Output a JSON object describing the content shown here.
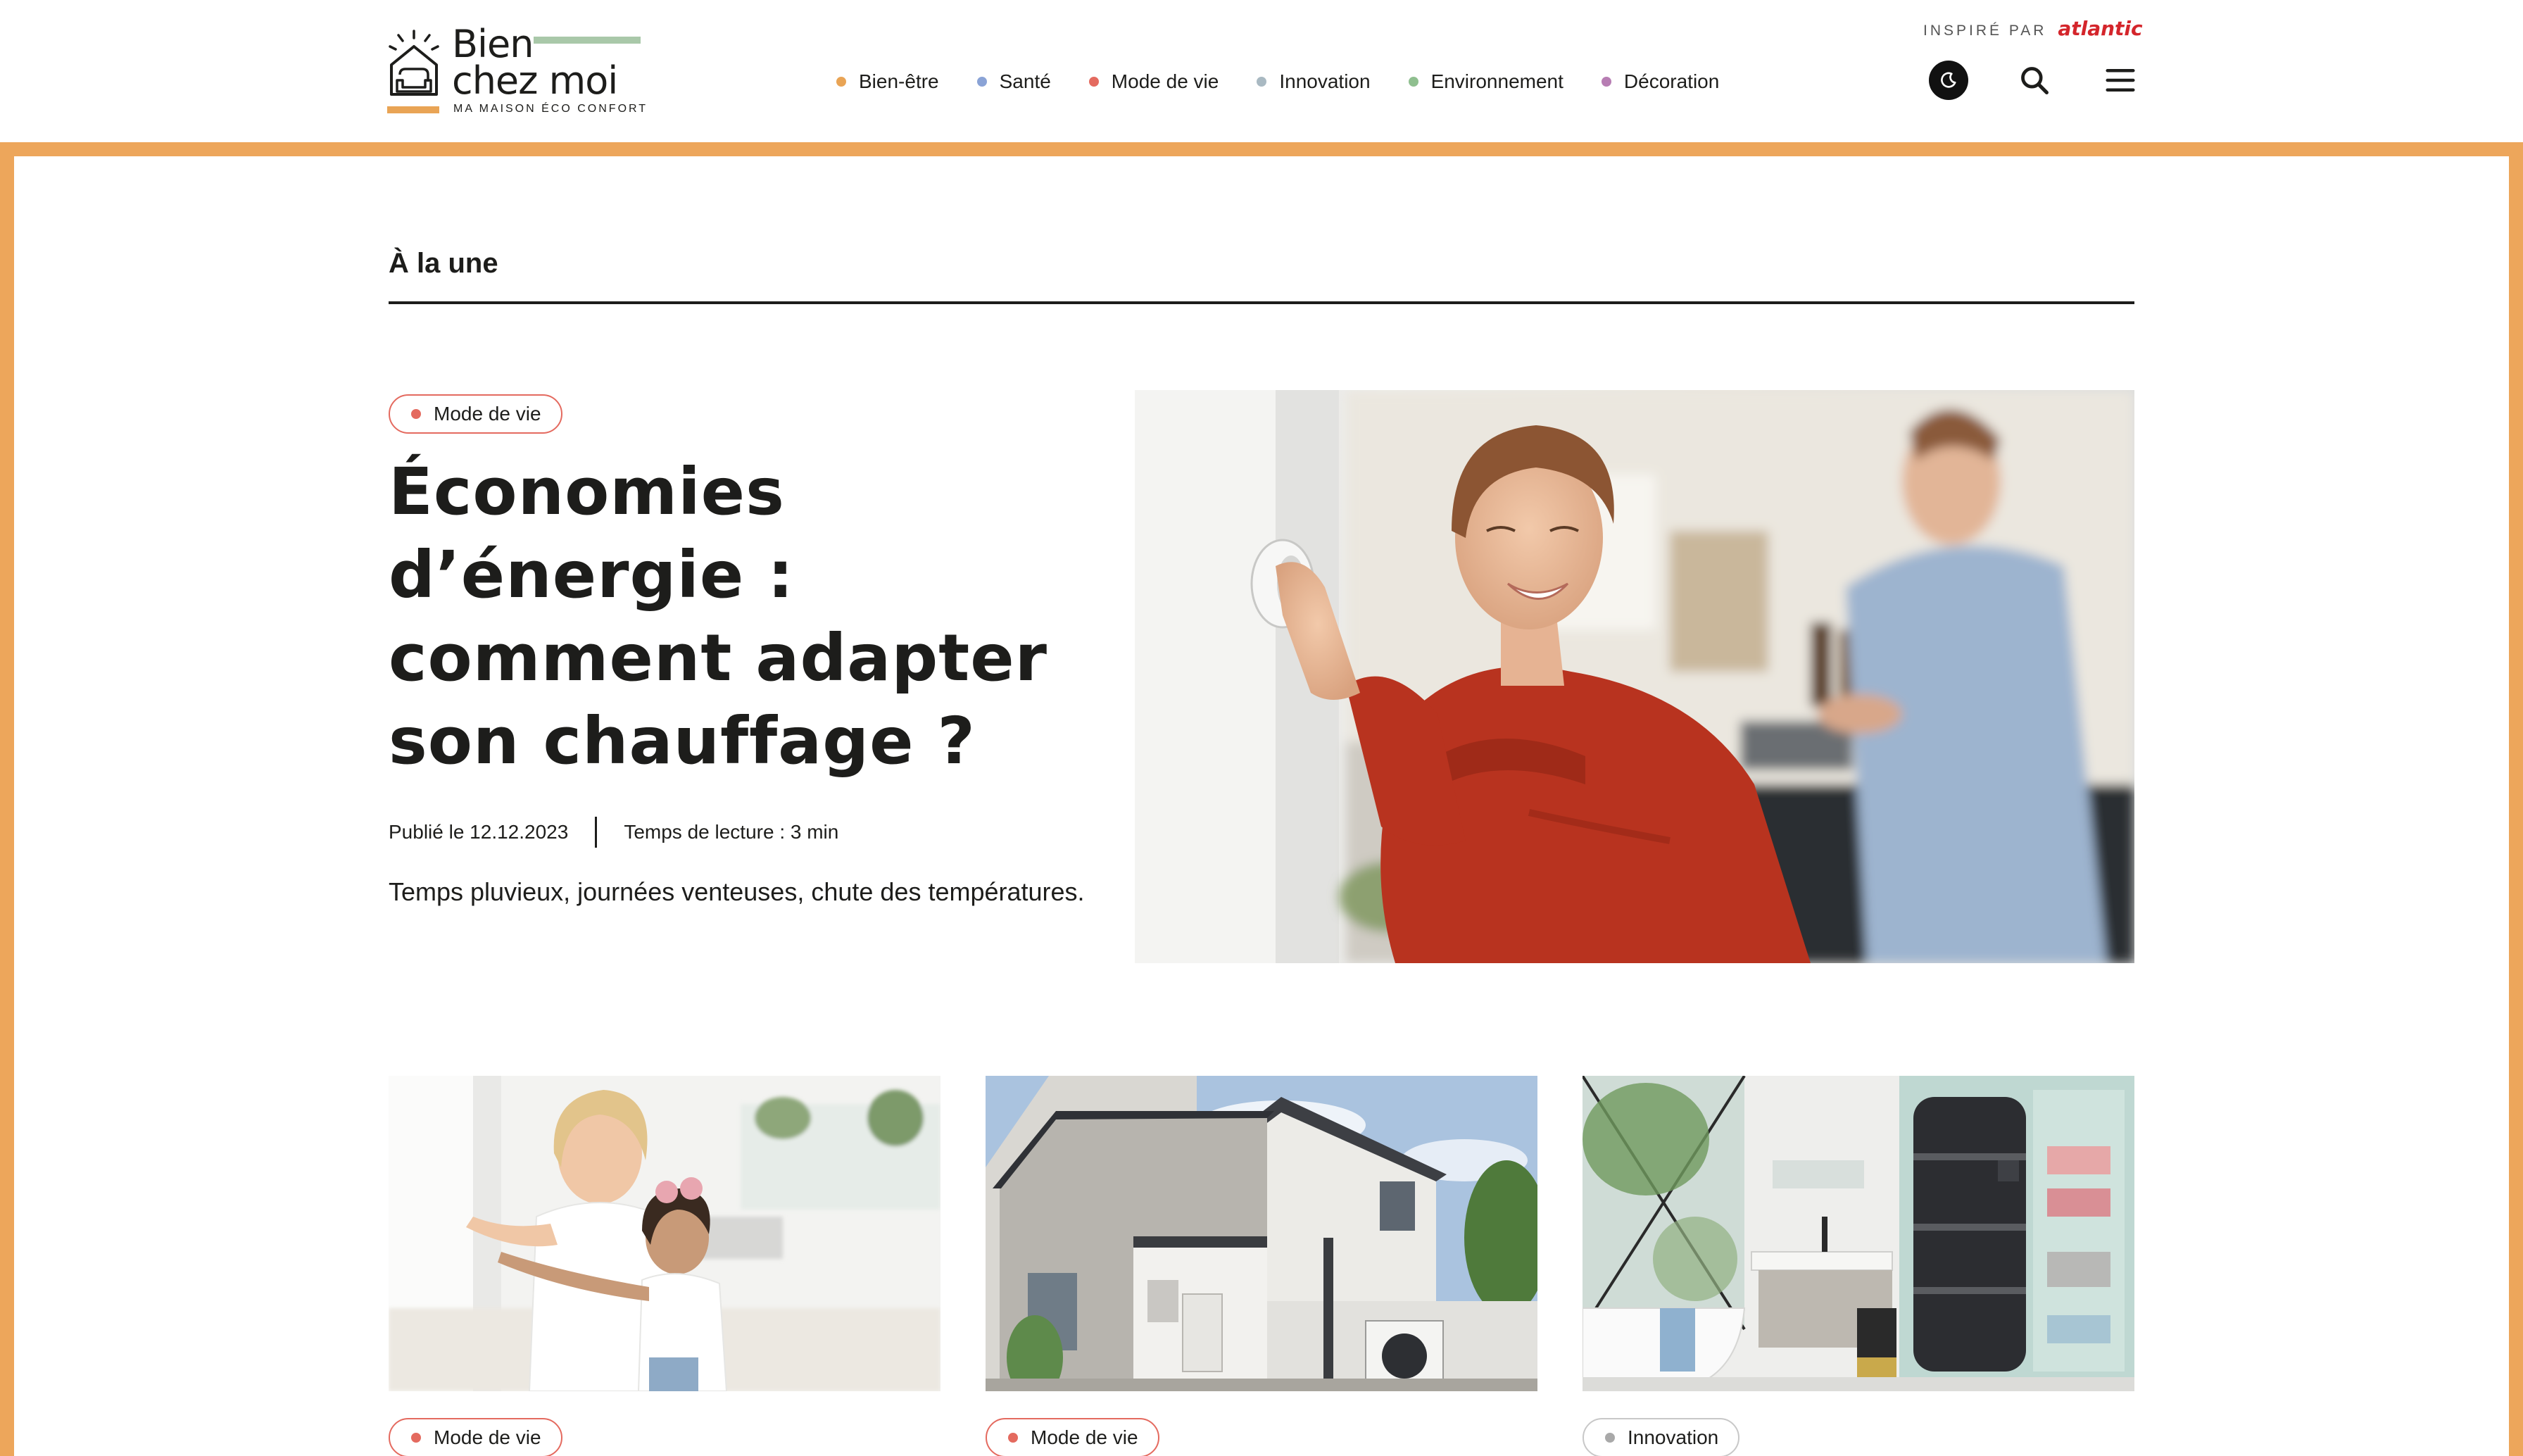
{
  "logo": {
    "line1": "Bien",
    "line2": "chez moi",
    "tagline": "MA MAISON ÉCO CONFORT"
  },
  "inspired": {
    "prefix": "INSPIRÉ PAR",
    "brand": "atlantic",
    "brand_color": "#d4252b"
  },
  "nav": {
    "items": [
      {
        "label": "Bien-être",
        "color": "#e9a455"
      },
      {
        "label": "Santé",
        "color": "#8aa3d6"
      },
      {
        "label": "Mode de vie",
        "color": "#e46a5f"
      },
      {
        "label": "Innovation",
        "color": "#a9b9c2"
      },
      {
        "label": "Environnement",
        "color": "#8fbf8f"
      },
      {
        "label": "Décoration",
        "color": "#b77db3"
      }
    ]
  },
  "header_icons": [
    "moon-icon",
    "search-icon",
    "menu-icon"
  ],
  "frame_color": "#eda65b",
  "section": {
    "title": "À la une"
  },
  "hero": {
    "tag": "Mode de vie",
    "title": "Économies d’énergie : comment adapter son chauffage ?",
    "published": "Publié le 12.12.2023",
    "reading_time": "Temps de lecture : 3 min",
    "excerpt": "Temps pluvieux, journées venteuses, chute des températures."
  },
  "cards": [
    {
      "tag": "Mode de vie"
    },
    {
      "tag": "Mode de vie"
    },
    {
      "tag": "Innovation"
    }
  ]
}
